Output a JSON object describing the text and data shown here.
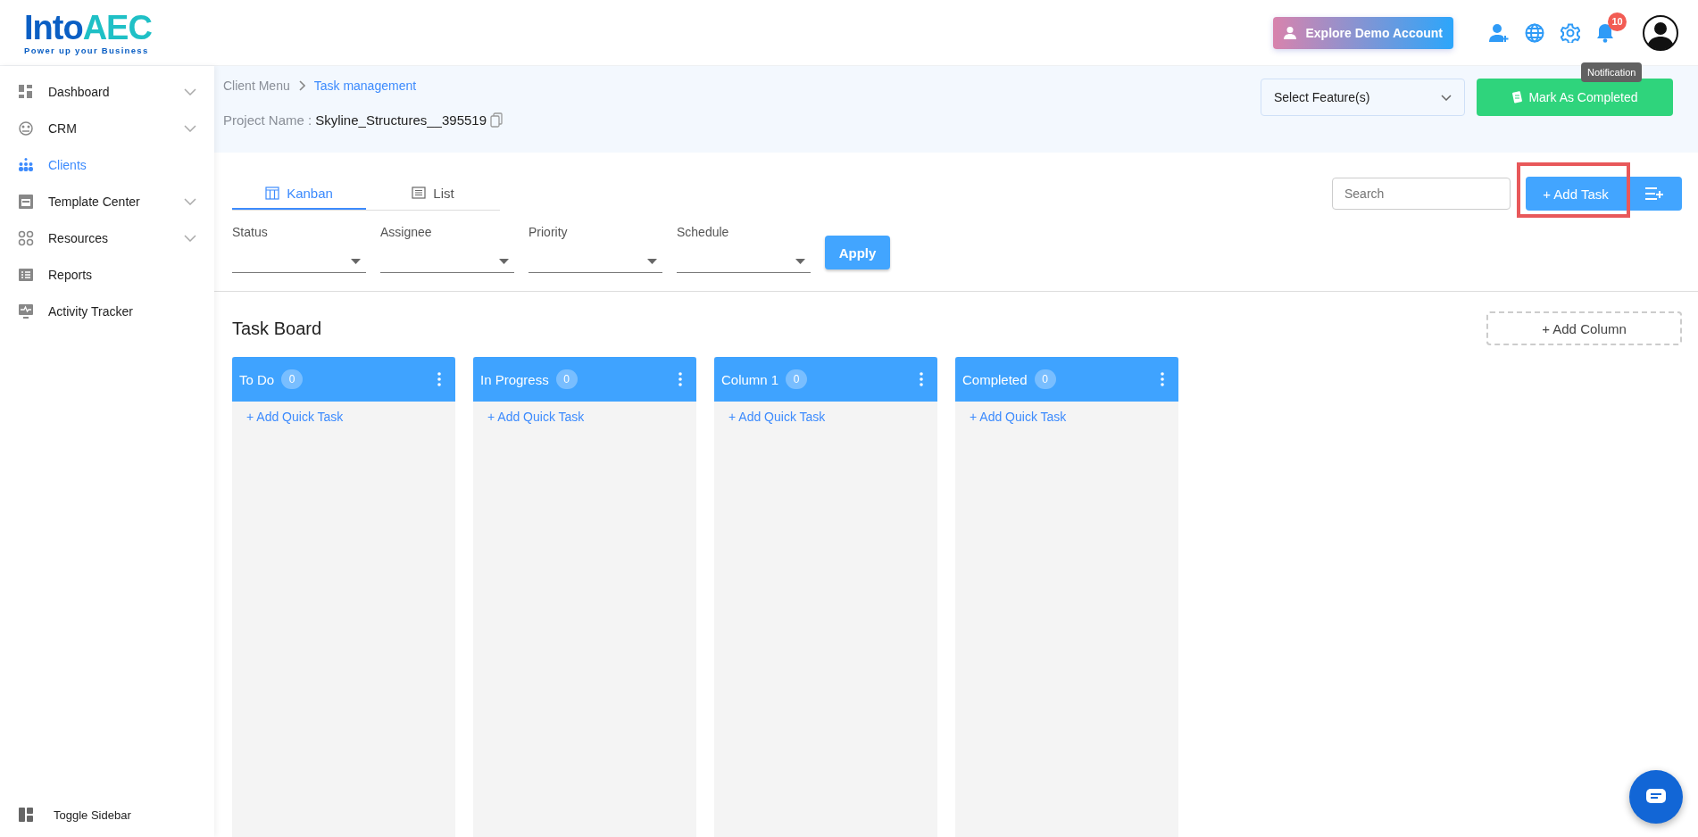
{
  "logo": {
    "primary": "Into",
    "accent": "AEC",
    "tagline": "Power up your Business"
  },
  "header": {
    "demo_button": "Explore Demo Account",
    "notification_count": "10",
    "tooltip": "Notification"
  },
  "sidebar": {
    "items": [
      {
        "label": "Dashboard",
        "expandable": true,
        "selected": false
      },
      {
        "label": "CRM",
        "expandable": true,
        "selected": false
      },
      {
        "label": "Clients",
        "expandable": false,
        "selected": true
      },
      {
        "label": "Template Center",
        "expandable": true,
        "selected": false
      },
      {
        "label": "Resources",
        "expandable": true,
        "selected": false
      },
      {
        "label": "Reports",
        "expandable": false,
        "selected": false
      },
      {
        "label": "Activity Tracker",
        "expandable": false,
        "selected": false
      }
    ],
    "toggle": "Toggle Sidebar"
  },
  "breadcrumb": [
    "Client Menu",
    "Task management"
  ],
  "project": {
    "label": "Project Name :",
    "value": "Skyline_Structures__395519"
  },
  "feature_select": {
    "placeholder": "Select Feature(s)"
  },
  "mark_completed": "Mark As Completed",
  "tabs": [
    {
      "label": "Kanban",
      "selected": true
    },
    {
      "label": "List",
      "selected": false
    }
  ],
  "search": {
    "placeholder": "Search"
  },
  "add_task": "+ Add Task",
  "filters": [
    {
      "label": "Status"
    },
    {
      "label": "Assignee"
    },
    {
      "label": "Priority"
    },
    {
      "label": "Schedule"
    }
  ],
  "apply": "Apply",
  "board": {
    "title": "Task Board",
    "add_column": "+ Add Column",
    "columns": [
      {
        "title": "To Do",
        "count": "0",
        "quick_add": "+ Add Quick Task"
      },
      {
        "title": "In Progress",
        "count": "0",
        "quick_add": "+ Add Quick Task"
      },
      {
        "title": "Column 1",
        "count": "0",
        "quick_add": "+ Add Quick Task"
      },
      {
        "title": "Completed",
        "count": "0",
        "quick_add": "+ Add Quick Task"
      }
    ]
  }
}
